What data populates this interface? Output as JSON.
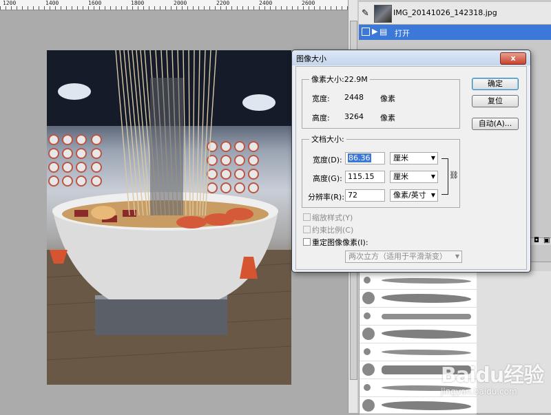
{
  "ruler": {
    "ticks": [
      "1200",
      "1400",
      "1600",
      "1800",
      "2000",
      "2200",
      "2400",
      "2600"
    ]
  },
  "history": {
    "snapshot_label": "IMG_20141026_142318.jpg",
    "step_label": "打开"
  },
  "dialog": {
    "title": "图像大小",
    "close_label": "x",
    "pixel_group": {
      "title": "像素大小:22.9M",
      "width_label": "宽度:",
      "width_value": "2448",
      "width_unit": "像素",
      "height_label": "高度:",
      "height_value": "3264",
      "height_unit": "像素"
    },
    "doc_group": {
      "title": "文档大小:",
      "width_label": "宽度(D):",
      "width_value": "86.36",
      "width_unit": "厘米",
      "height_label": "高度(G):",
      "height_value": "115.15",
      "height_unit": "厘米",
      "res_label": "分辨率(R):",
      "res_value": "72",
      "res_unit": "像素/英寸"
    },
    "options": {
      "scale_styles": "缩放样式(Y)",
      "constrain": "约束比例(C)",
      "resample": "重定图像像素(I):",
      "resample_method": "两次立方（适用于平滑渐变）"
    },
    "buttons": {
      "ok": "确定",
      "reset": "复位",
      "auto": "自动(A)..."
    }
  },
  "watermark": {
    "logo": "Baidu经验",
    "url": "jingyan.baidu.com"
  }
}
